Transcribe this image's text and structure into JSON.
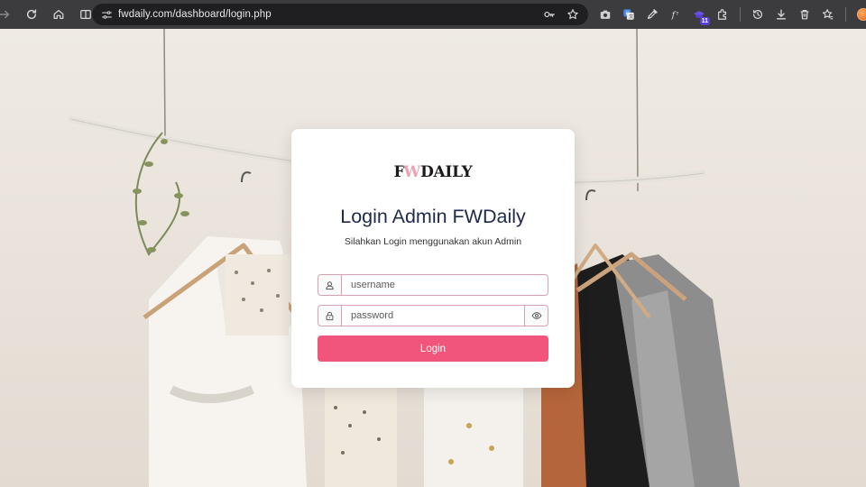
{
  "browser": {
    "url": "fwdaily.com/dashboard/login.php",
    "extensions": [
      "camera-icon",
      "translate-icon",
      "eyedropper-icon",
      "font-icon",
      "graduation-cap-icon",
      "puzzle-icon"
    ],
    "extension_badge": "11",
    "actions": [
      "history-icon",
      "download-icon",
      "trash-icon",
      "bookmarks-icon",
      "profile-avatar"
    ]
  },
  "login": {
    "logo_text_1": "F",
    "logo_text_accent": "W",
    "logo_text_2": "DAILY",
    "title": "Login Admin FWDaily",
    "subtitle": "Silahkan Login menggunakan akun Admin",
    "username_placeholder": "username",
    "password_placeholder": "password",
    "button_label": "Login"
  },
  "colors": {
    "accent": "#f2557b",
    "field_border": "#d7a2ad",
    "title": "#1e2a4a",
    "logo_accent": "#e9a3b4"
  }
}
